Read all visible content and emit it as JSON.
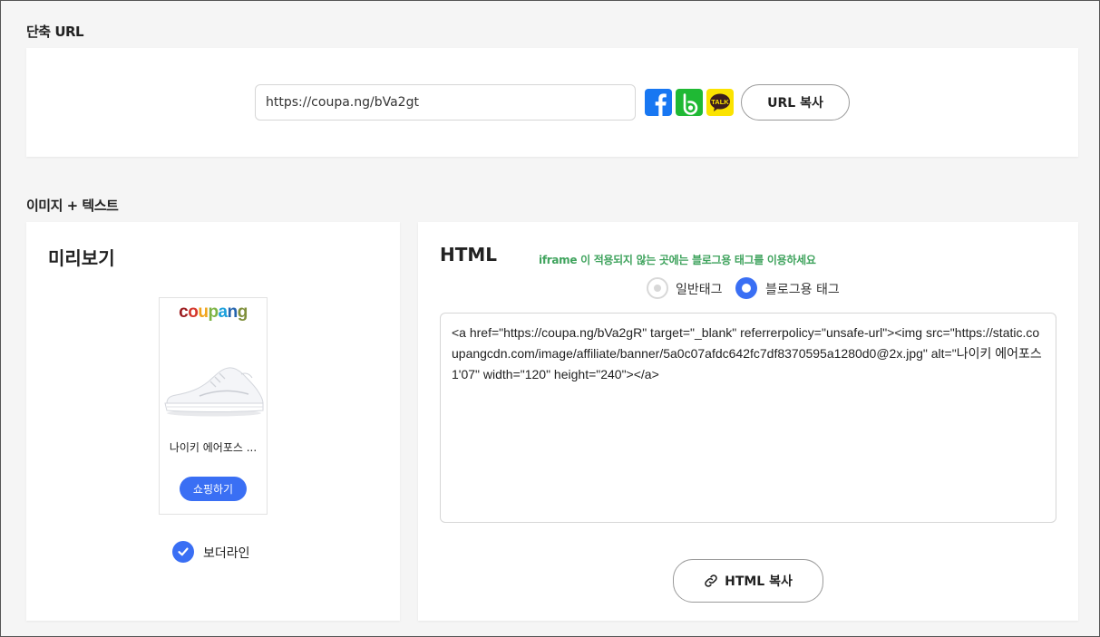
{
  "short_url": {
    "section_title": "단축 URL",
    "url_value": "https://coupa.ng/bVa2gt",
    "copy_button": "URL 복사",
    "icons": [
      "facebook-icon",
      "band-icon",
      "kakaotalk-icon"
    ],
    "kakao_text": "TALK"
  },
  "image_text": {
    "section_title": "이미지 + 텍스트",
    "preview": {
      "title": "미리보기",
      "banner": {
        "logo": "coupang",
        "product_name": "나이키 에어포스 ...",
        "shop_button": "쇼핑하기"
      },
      "borderline_label": "보더라인",
      "borderline_checked": true
    },
    "html": {
      "title": "HTML",
      "notice": "iframe 이 적용되지 않는 곳에는 블로그용 태그를 이용하세요",
      "radio_general": "일반태그",
      "radio_blog": "블로그용 태그",
      "selected": "블로그용 태그",
      "code": "<a href=\"https://coupa.ng/bVa2gR\" target=\"_blank\" referrerpolicy=\"unsafe-url\"><img src=\"https://static.coupangcdn.com/image/affiliate/banner/5a0c07afdc642fc7df8370595a1280d0@2x.jpg\" alt=\"나이키 에어포스 1'07\" width=\"120\" height=\"240\"></a>",
      "copy_button": "HTML 복사"
    }
  },
  "colors": {
    "accent": "#3a6ff4",
    "notice": "#3fa35d",
    "background": "#f5f5f5",
    "coupang_c": "#9b1b1f",
    "coupang_o": "#d5372c",
    "coupang_u": "#f0a31a",
    "coupang_p": "#7cb343",
    "coupang_a": "#1ba0dc",
    "coupang_n": "#2564ae",
    "coupang_g": "#7f8f3a"
  }
}
